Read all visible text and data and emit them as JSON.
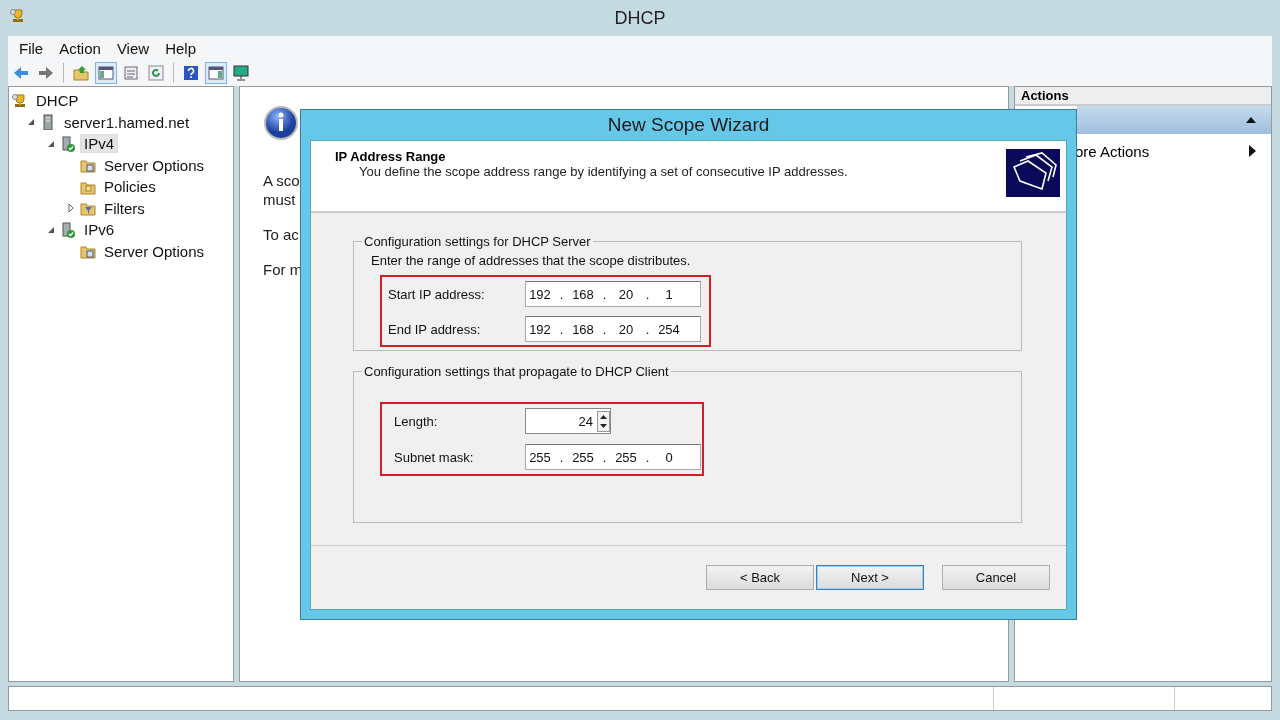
{
  "window": {
    "title": "DHCP"
  },
  "menu": [
    "File",
    "Action",
    "View",
    "Help"
  ],
  "toolbar": [
    {
      "pressed": false
    },
    {
      "pressed": false
    },
    {
      "pressed": false
    },
    {
      "pressed": true
    },
    {
      "pressed": false
    },
    {
      "pressed": false
    },
    {
      "pressed": false
    },
    {
      "pressed": true
    },
    {
      "pressed": false
    }
  ],
  "tree": [
    {
      "label": "DHCP",
      "kind": "root",
      "children": [
        {
          "label": "server1.hamed.net",
          "kind": "server",
          "expanded": true,
          "children": [
            {
              "label": "IPv4",
              "kind": "protocol",
              "expanded": true,
              "selected": true,
              "children": [
                {
                  "label": "Server Options",
                  "kind": "options",
                  "selected": false
                },
                {
                  "label": "Policies",
                  "kind": "policies",
                  "selected": false
                },
                {
                  "label": "Filters",
                  "kind": "filters",
                  "expanded": false,
                  "selected": false
                }
              ]
            },
            {
              "label": "IPv6",
              "kind": "protocol",
              "expanded": true,
              "selected": false,
              "children": [
                {
                  "label": "Server Options",
                  "kind": "options",
                  "selected": false
                }
              ]
            }
          ]
        }
      ]
    }
  ],
  "center": {
    "paragraphs": [
      [
        "A sco",
        "must"
      ],
      [
        "To ac"
      ],
      [
        "For m"
      ]
    ]
  },
  "actions": {
    "title": "Actions",
    "section_expanded": true,
    "items": [
      "ore Actions"
    ]
  },
  "dialog": {
    "title": "New Scope Wizard",
    "heading": "IP Address Range",
    "subheading": "You define the scope address range by identifying a set of consecutive IP addresses.",
    "groups": [
      {
        "legend": "Configuration settings for DHCP Server",
        "description": "Enter the range of addresses that the scope distributes.",
        "rows": [
          {
            "kind": "ip",
            "label": "Start IP address:",
            "octets": [
              "192",
              "168",
              "20",
              "1"
            ],
            "separator": "."
          },
          {
            "kind": "ip",
            "label": "End IP address:",
            "octets": [
              "192",
              "168",
              "20",
              "254"
            ],
            "separator": "."
          }
        ]
      },
      {
        "legend": "Configuration settings that propagate to DHCP Client",
        "rows": [
          {
            "kind": "spin",
            "label": "Length:",
            "value": "24"
          },
          {
            "kind": "ip",
            "label": "Subnet mask:",
            "octets": [
              "255",
              "255",
              "255",
              "0"
            ],
            "separator": "."
          }
        ]
      }
    ],
    "buttons": [
      {
        "label": "< Back",
        "default": false
      },
      {
        "label": "Next >",
        "default": true
      },
      {
        "label": "Cancel",
        "default": false
      }
    ]
  }
}
